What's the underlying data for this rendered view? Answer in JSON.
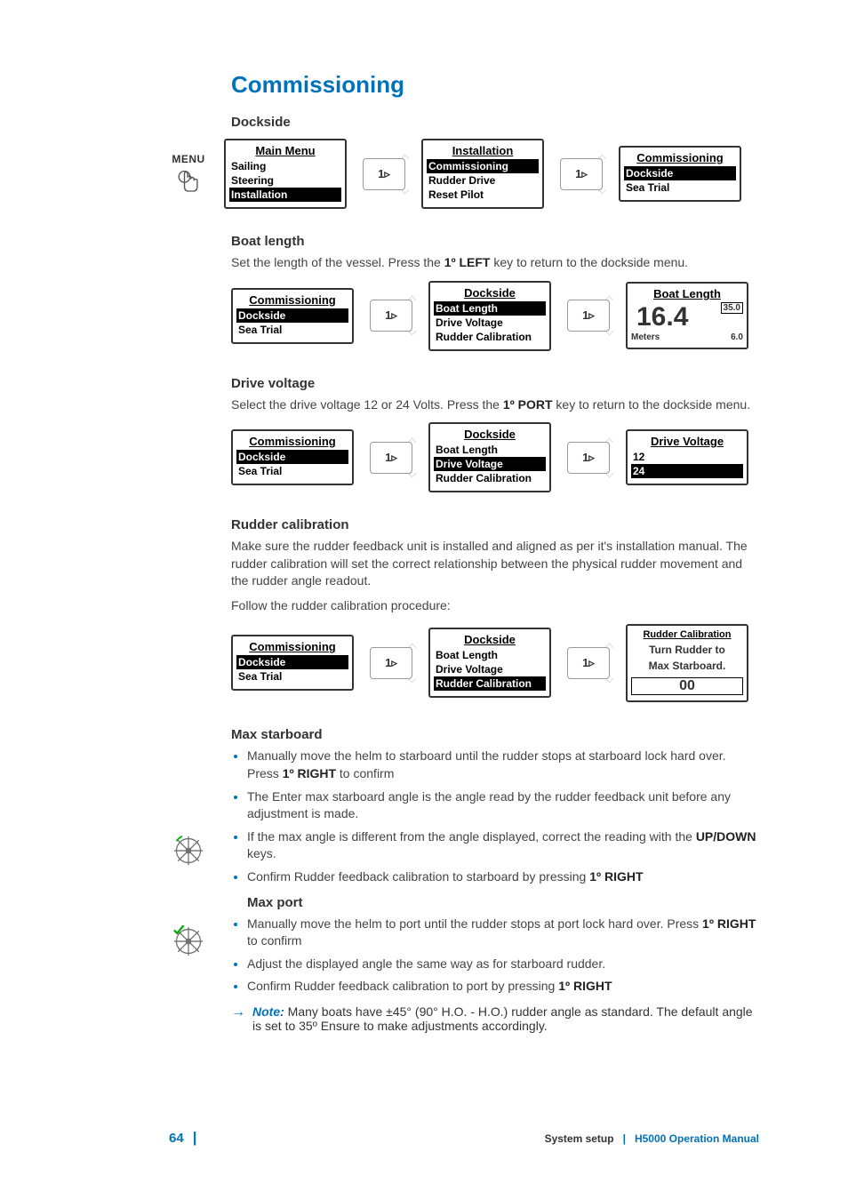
{
  "page": {
    "number": "64",
    "sectionLabel": "System setup",
    "manualLabel": "H5000 Operation Manual"
  },
  "heading": "Commissioning",
  "margin": {
    "menuLabel": "MENU"
  },
  "dockside": {
    "heading": "Dockside",
    "flow": {
      "key": "1▹",
      "screen1": {
        "title": "Main Menu",
        "items": [
          "Sailing",
          "Steering",
          "Installation"
        ],
        "highlightIndex": 2
      },
      "screen2": {
        "title": "Installation",
        "items": [
          "Commissioning",
          "Rudder Drive",
          "Reset Pilot"
        ],
        "highlightIndex": 0
      },
      "screen3": {
        "title": "Commissioning",
        "items": [
          "Dockside",
          "Sea Trial"
        ],
        "highlightIndex": 0
      }
    }
  },
  "boatLength": {
    "heading": "Boat length",
    "text_pre": "Set the length of the vessel. Press the ",
    "text_key": "1º LEFT",
    "text_post": " key to return to the dockside menu.",
    "flow": {
      "key": "1▹",
      "screen1": {
        "title": "Commissioning",
        "items": [
          "Dockside",
          "Sea Trial"
        ],
        "highlightIndex": 0
      },
      "screen2": {
        "title": "Dockside",
        "items": [
          "Boat Length",
          "Drive Voltage",
          "Rudder Calibration"
        ],
        "highlightIndex": 0
      },
      "screen3": {
        "title": "Boat Length",
        "value": "16.4",
        "unit": "Meters",
        "sideTop": "35.0",
        "sideBottom": "6.0"
      }
    }
  },
  "driveVoltage": {
    "heading": "Drive voltage",
    "text_pre": "Select the drive voltage 12 or 24 Volts. Press the ",
    "text_key": "1º PORT",
    "text_post": " key to return to the dockside menu.",
    "flow": {
      "key": "1▹",
      "screen1": {
        "title": "Commissioning",
        "items": [
          "Dockside",
          "Sea Trial"
        ],
        "highlightIndex": 0
      },
      "screen2": {
        "title": "Dockside",
        "items": [
          "Boat Length",
          "Drive Voltage",
          "Rudder Calibration"
        ],
        "highlightIndex": 1
      },
      "screen3": {
        "title": "Drive Voltage",
        "items": [
          "12",
          "24"
        ],
        "highlightIndex": 1
      }
    }
  },
  "rudderCal": {
    "heading": "Rudder calibration",
    "para1": "Make sure the rudder feedback unit is installed and aligned as per it's installation manual. The rudder calibration will set the correct relationship between the physical rudder movement and the rudder angle readout.",
    "para2": "Follow the rudder calibration procedure:",
    "flow": {
      "key": "1▹",
      "screen1": {
        "title": "Commissioning",
        "items": [
          "Dockside",
          "Sea Trial"
        ],
        "highlightIndex": 0
      },
      "screen2": {
        "title": "Dockside",
        "items": [
          "Boat Length",
          "Drive Voltage",
          "Rudder Calibration"
        ],
        "highlightIndex": 2
      },
      "screen3": {
        "title": "Rudder Calibration",
        "msg1": "Turn Rudder to",
        "msg2": "Max Starboard.",
        "value": "00"
      }
    }
  },
  "maxStarboard": {
    "heading": "Max starboard",
    "b1_pre": "Manually move the helm to starboard until the rudder stops at starboard lock hard over. Press ",
    "b1_key": "1º RIGHT",
    "b1_post": " to confirm",
    "b2": "The Enter max starboard angle is the angle read by the rudder feedback unit before any adjustment is made.",
    "b3_pre": "If the max angle is different from the angle displayed, correct the reading with the ",
    "b3_key": "UP/DOWN",
    "b3_post": " keys.",
    "b4_pre": "Confirm Rudder feedback calibration to starboard by pressing ",
    "b4_key": "1º RIGHT"
  },
  "maxPort": {
    "heading": "Max port",
    "b1_pre": "Manually move the helm to port until the rudder stops at port lock hard over. Press ",
    "b1_key": "1º RIGHT",
    "b1_post": " to confirm",
    "b2": "Adjust the displayed angle the same way as for starboard rudder.",
    "b3_pre": "Confirm Rudder feedback calibration to port by pressing ",
    "b3_key": "1º RIGHT"
  },
  "note": {
    "arrow": "→",
    "label": "Note:",
    "text": " Many boats have ±45° (90° H.O. - H.O.) rudder angle as standard. The default angle is set to 35º Ensure to make adjustments accordingly."
  }
}
